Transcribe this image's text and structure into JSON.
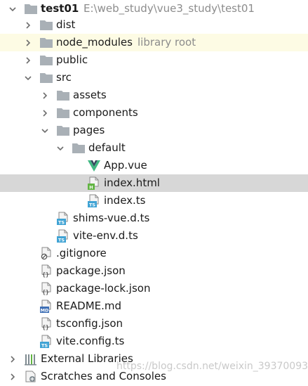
{
  "tree": [
    {
      "name": "project-root",
      "label": "test01",
      "path": "E:\\web_study\\vue3_study\\test01",
      "icon": "folder-icon",
      "expanded": true
    },
    {
      "name": "folder-dist",
      "label": "dist",
      "icon": "folder-icon",
      "expanded": false
    },
    {
      "name": "folder-node-modules",
      "label": "node_modules",
      "note": "library root",
      "icon": "folder-icon",
      "expanded": false
    },
    {
      "name": "folder-public",
      "label": "public",
      "icon": "folder-icon",
      "expanded": false
    },
    {
      "name": "folder-src",
      "label": "src",
      "icon": "folder-icon",
      "expanded": true
    },
    {
      "name": "folder-assets",
      "label": "assets",
      "icon": "folder-icon",
      "expanded": false
    },
    {
      "name": "folder-components",
      "label": "components",
      "icon": "folder-icon",
      "expanded": false
    },
    {
      "name": "folder-pages",
      "label": "pages",
      "icon": "folder-icon",
      "expanded": true
    },
    {
      "name": "folder-default",
      "label": "default",
      "icon": "folder-icon",
      "expanded": true
    },
    {
      "name": "file-app-vue",
      "label": "App.vue",
      "icon": "vue-file-icon"
    },
    {
      "name": "file-index-html",
      "label": "index.html",
      "icon": "html-file-icon",
      "selected": true
    },
    {
      "name": "file-index-ts",
      "label": "index.ts",
      "icon": "ts-file-icon"
    },
    {
      "name": "file-shims-vue-d-ts",
      "label": "shims-vue.d.ts",
      "icon": "ts-file-icon"
    },
    {
      "name": "file-vite-env-d-ts",
      "label": "vite-env.d.ts",
      "icon": "ts-file-icon"
    },
    {
      "name": "file-gitignore",
      "label": ".gitignore",
      "icon": "ignore-file-icon"
    },
    {
      "name": "file-package-json",
      "label": "package.json",
      "icon": "json-file-icon"
    },
    {
      "name": "file-package-lock-json",
      "label": "package-lock.json",
      "icon": "json-file-icon"
    },
    {
      "name": "file-readme-md",
      "label": "README.md",
      "icon": "md-file-icon"
    },
    {
      "name": "file-tsconfig-json",
      "label": "tsconfig.json",
      "icon": "json-file-icon"
    },
    {
      "name": "file-vite-config-ts",
      "label": "vite.config.ts",
      "icon": "ts-file-icon"
    },
    {
      "name": "external-libraries",
      "label": "External Libraries",
      "icon": "library-icon",
      "expanded": false
    },
    {
      "name": "scratches-and-consoles",
      "label": "Scratches and Consoles",
      "icon": "scratch-icon",
      "expanded": false
    }
  ],
  "watermark": "https://blog.csdn.net/weixin_39370093",
  "colors": {
    "folder": "#a9b0b6",
    "vue": "#41b883",
    "vue_dark": "#35495e",
    "html_badge": "#62b543",
    "ts_badge": "#40a3d4",
    "md_badge": "#3e6fb5",
    "selection": "#d7d7d7",
    "library_root_bg": "#fdfbe4"
  }
}
